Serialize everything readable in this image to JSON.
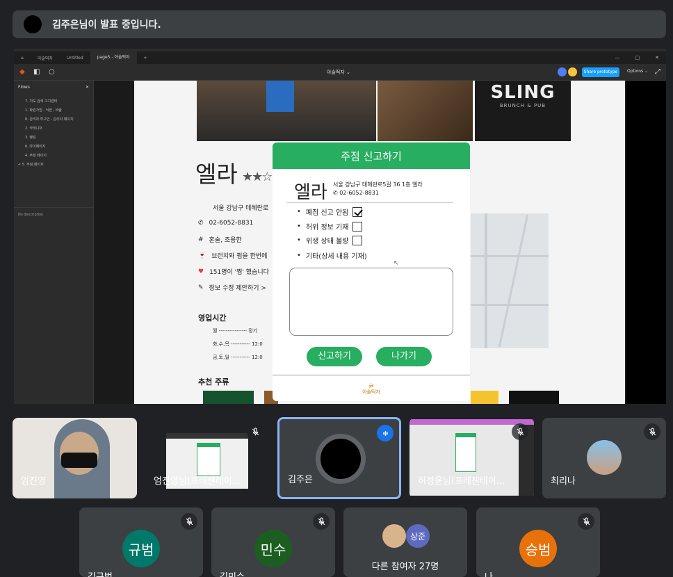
{
  "banner": {
    "text": "김주은님이 발표 중입니다."
  },
  "figma": {
    "tabs": [
      "아술떡자",
      "Untitled",
      "page5 - 아술떡자"
    ],
    "window_controls": [
      "—",
      "□",
      "✕"
    ],
    "file_title": "아술떡자",
    "share_button": "Share prototype",
    "options": "Options",
    "flows_title": "Flows",
    "flows": [
      "7. 지도 검색 고치센터",
      "1. 화원가입 - 닉한 , 바람",
      "8. 관리자 투고인 - 관리자 페이지",
      "2. 카테니처",
      "3. 랭킹",
      "6. 마이페이지",
      "4. 주점 페이지",
      "5. 주점 페이지"
    ],
    "no_description": "No description"
  },
  "restaurant_page": {
    "photo3_title": "SLING",
    "photo3_sub": "BRUNCH & PUB",
    "name": "엘라",
    "stars": "★★☆",
    "address": "서울 강남구 테헤란로",
    "phone": "02-6052-8831",
    "owner": "혼술, 조용한",
    "desc": "브런치와 펍을 한번에",
    "likes": "151명이 '찜' 했습니다",
    "edit": "정보 수정 제안하기 >",
    "hours_title": "영업시간",
    "hours": [
      "월 ---------------- 정기",
      "화,수,목 ----------- 12:0",
      "금,토,일 ----------- 12:0"
    ],
    "drinks_title": "추천 주류"
  },
  "modal": {
    "title": "주점 신고하기",
    "name": "엘라",
    "address": "서울 강남구 테헤란로5길 36 1층 엘라",
    "phone": "02-6052-8831",
    "options": [
      {
        "label": "폐점 신고 안됨",
        "checked": true
      },
      {
        "label": "허위 정보 기재",
        "checked": false
      },
      {
        "label": "위생 상태 불량",
        "checked": false
      },
      {
        "label": "기타(상세 내용 기재)",
        "checked": null
      }
    ],
    "report_button": "신고하기",
    "exit_button": "나가기",
    "logo": "아술떡자"
  },
  "participants_row1": [
    {
      "name": "엄진영",
      "muted": false
    },
    {
      "name": "엄진영님(프레젠테이...",
      "muted": true
    },
    {
      "name": "김주은",
      "speaking": true
    },
    {
      "name": "허정윤님(프레젠테이...",
      "muted": true
    },
    {
      "name": "최리나",
      "muted": true
    }
  ],
  "participants_row2": [
    {
      "initials": "규범",
      "name": "김규범",
      "color": "#00796b",
      "muted": true
    },
    {
      "initials": "민수",
      "name": "김민수",
      "color": "#1b5e20",
      "muted": true
    },
    {
      "initials": "상준",
      "name": "다른 참여자 27명",
      "color": "#5c6bc0"
    },
    {
      "initials": "승범",
      "name": "나",
      "color": "#e8710a",
      "muted": true
    }
  ]
}
